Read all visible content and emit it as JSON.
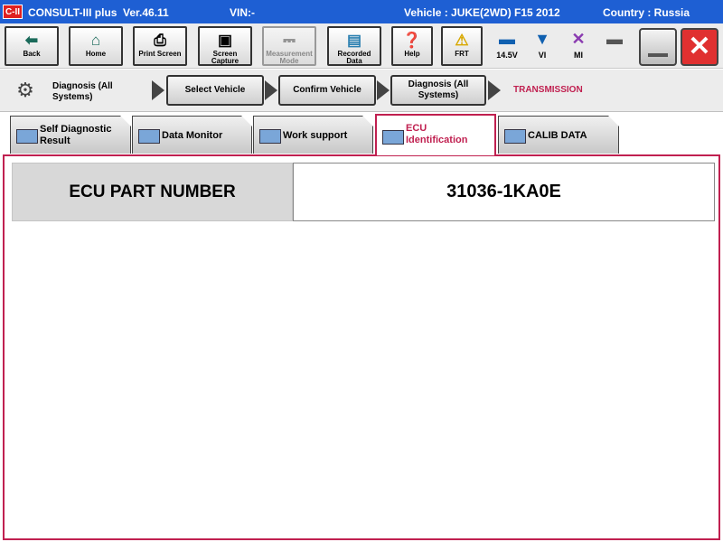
{
  "titlebar": {
    "logo": "C-II",
    "app_name": "CONSULT-III plus",
    "version": "Ver.46.11",
    "vin_label": "VIN:-",
    "vehicle": "Vehicle : JUKE(2WD) F15 2012",
    "country": "Country : Russia"
  },
  "toolbar": {
    "back": "Back",
    "home": "Home",
    "print_screen": "Print Screen",
    "screen_capture": [
      "Screen",
      "Capture"
    ],
    "measurement_mode": [
      "Measurement",
      "Mode"
    ],
    "recorded_data": [
      "Recorded",
      "Data"
    ],
    "help": "Help",
    "frt": "FRT",
    "voltage": "14.5V",
    "vi": "VI",
    "mi": "MI"
  },
  "breadcrumb": {
    "diagnosis_header": [
      "Diagnosis (All",
      "Systems)"
    ],
    "select_vehicle": "Select Vehicle",
    "confirm_vehicle": "Confirm Vehicle",
    "diagnosis_all": [
      "Diagnosis (All",
      "Systems)"
    ],
    "current": "TRANSMISSION"
  },
  "tabs": {
    "self_diagnostic": [
      "Self Diagnostic",
      "Result"
    ],
    "data_monitor": "Data Monitor",
    "work_support": "Work support",
    "ecu_identification": [
      "ECU",
      "Identification"
    ],
    "calib_data": "CALIB DATA"
  },
  "main": {
    "part_number_label": "ECU PART NUMBER",
    "part_number_value": "31036-1KA0E"
  },
  "colors": {
    "titlebar": "#1e5fd3",
    "accent": "#c02050",
    "close_button": "#e03030",
    "status_icon": "#1060b0"
  }
}
